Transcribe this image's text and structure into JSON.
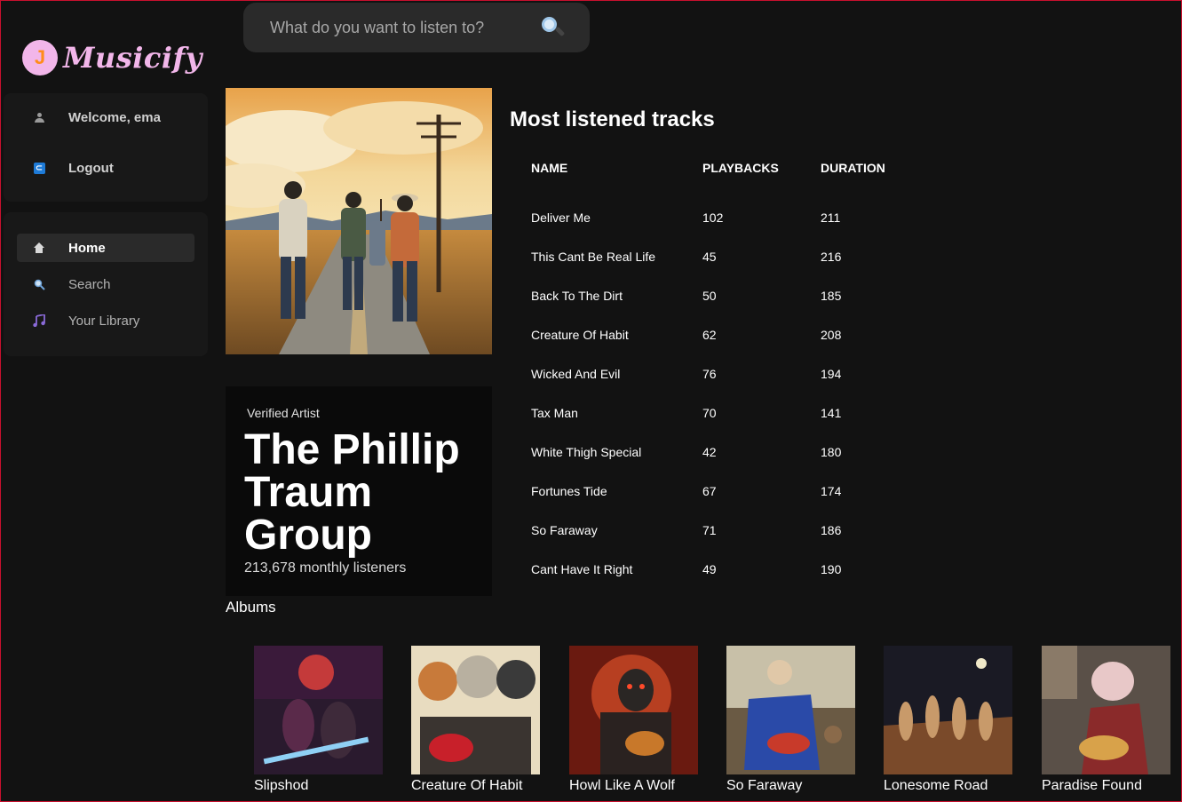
{
  "app": {
    "name": "Musicify",
    "logo_glyph": "J"
  },
  "search": {
    "placeholder": "What do you want to listen to?"
  },
  "sidebar": {
    "welcome": "Welcome, ema",
    "logout": "Logout",
    "nav": [
      {
        "label": "Home",
        "icon": "home-icon"
      },
      {
        "label": "Search",
        "icon": "search-icon"
      },
      {
        "label": "Your Library",
        "icon": "music-note-icon"
      }
    ]
  },
  "artist": {
    "verified": "Verified Artist",
    "name": "The Phillip Traum Group",
    "listeners": "213,678 monthly listeners"
  },
  "tracks": {
    "title": "Most listened tracks",
    "headers": {
      "name": "NAME",
      "playbacks": "PLAYBACKS",
      "duration": "DURATION"
    },
    "rows": [
      {
        "name": "Deliver Me",
        "playbacks": "102",
        "duration": "211"
      },
      {
        "name": "This Cant Be Real Life",
        "playbacks": "45",
        "duration": "216"
      },
      {
        "name": "Back To The Dirt",
        "playbacks": "50",
        "duration": "185"
      },
      {
        "name": "Creature Of Habit",
        "playbacks": "62",
        "duration": "208"
      },
      {
        "name": "Wicked And Evil",
        "playbacks": "76",
        "duration": "194"
      },
      {
        "name": "Tax Man",
        "playbacks": "70",
        "duration": "141"
      },
      {
        "name": "White Thigh Special",
        "playbacks": "42",
        "duration": "180"
      },
      {
        "name": "Fortunes Tide",
        "playbacks": "67",
        "duration": "174"
      },
      {
        "name": "So Faraway",
        "playbacks": "71",
        "duration": "186"
      },
      {
        "name": "Cant Have It Right",
        "playbacks": "49",
        "duration": "190"
      }
    ]
  },
  "albums": {
    "title": "Albums",
    "items": [
      {
        "title": "Slipshod"
      },
      {
        "title": "Creature Of Habit"
      },
      {
        "title": "Howl Like A Wolf"
      },
      {
        "title": "So Faraway"
      },
      {
        "title": "Lonesome Road"
      },
      {
        "title": "Paradise Found"
      }
    ]
  },
  "colors": {
    "background": "#121212",
    "panel": "#181818",
    "brand": "#f2b6ea",
    "accent": "#ff8c1a"
  }
}
